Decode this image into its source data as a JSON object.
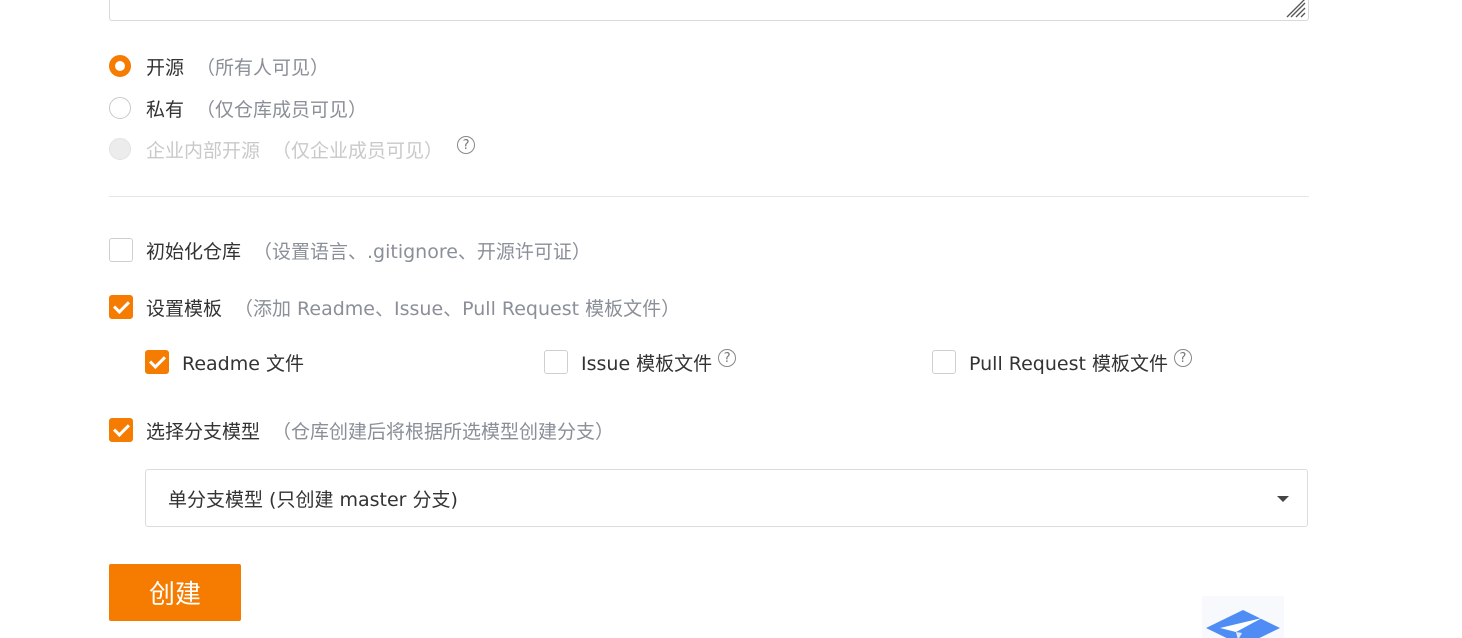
{
  "visibility": {
    "options": [
      {
        "label": "开源",
        "hint": "（所有人可见）",
        "state": "checked"
      },
      {
        "label": "私有",
        "hint": "（仅仓库成员可见）",
        "state": "unchecked"
      },
      {
        "label": "企业内部开源",
        "hint": "（仅企业成员可见）",
        "state": "disabled"
      }
    ],
    "help_symbol": "?"
  },
  "options": {
    "init_repo": {
      "label": "初始化仓库",
      "hint": "（设置语言、.gitignore、开源许可证）",
      "checked": false
    },
    "templates": {
      "label": "设置模板",
      "hint": "（添加 Readme、Issue、Pull Request 模板文件）",
      "checked": true
    },
    "template_items": [
      {
        "label": "Readme 文件",
        "checked": true
      },
      {
        "label": "Issue 模板文件",
        "checked": false,
        "help": "?"
      },
      {
        "label": "Pull Request 模板文件",
        "checked": false,
        "help": "?"
      }
    ],
    "branch_model": {
      "label": "选择分支模型",
      "hint": "（仓库创建后将根据所选模型创建分支）",
      "checked": true
    },
    "branch_select": {
      "value": "单分支模型 (只创建 master 分支)"
    }
  },
  "actions": {
    "create_label": "创建"
  },
  "colors": {
    "accent": "#f57c00",
    "hint": "#8a8f98",
    "disabled": "#c9c9c9",
    "widget_blue": "#4f8df5"
  },
  "icons": {
    "help": "question-circle-icon",
    "caret": "caret-down-icon",
    "widget": "paper-plane-icon"
  }
}
